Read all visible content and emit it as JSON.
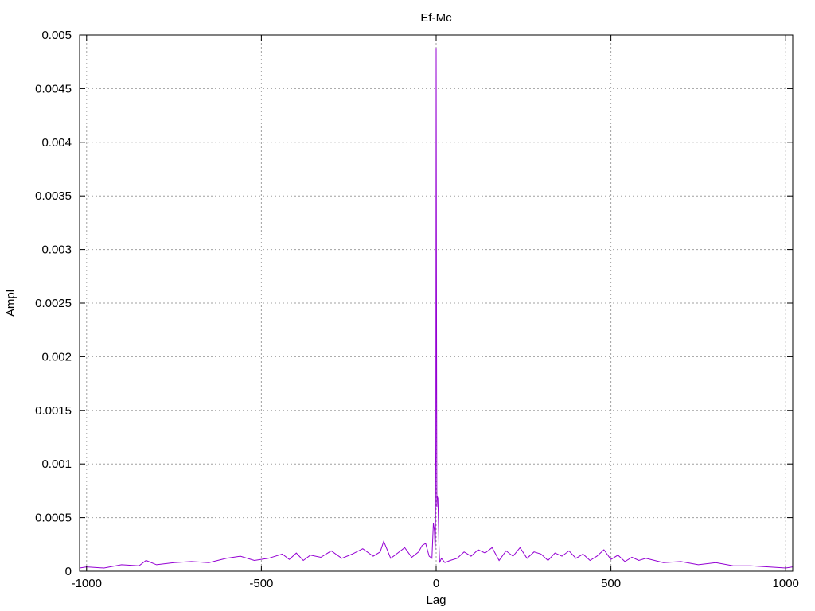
{
  "chart_data": {
    "type": "line",
    "title": "Ef-Mc",
    "xlabel": "Lag",
    "ylabel": "Ampl",
    "xlim": [
      -1020,
      1020
    ],
    "ylim": [
      0,
      0.005
    ],
    "grid": true,
    "xticks": [
      {
        "value": -1000,
        "label": "-1000"
      },
      {
        "value": -500,
        "label": "-500"
      },
      {
        "value": 0,
        "label": "0"
      },
      {
        "value": 500,
        "label": "500"
      },
      {
        "value": 1000,
        "label": "1000"
      }
    ],
    "yticks": [
      {
        "value": 0,
        "label": "0"
      },
      {
        "value": 0.0005,
        "label": "0.0005"
      },
      {
        "value": 0.001,
        "label": "0.001"
      },
      {
        "value": 0.0015,
        "label": "0.0015"
      },
      {
        "value": 0.002,
        "label": "0.002"
      },
      {
        "value": 0.0025,
        "label": "0.0025"
      },
      {
        "value": 0.003,
        "label": "0.003"
      },
      {
        "value": 0.0035,
        "label": "0.0035"
      },
      {
        "value": 0.004,
        "label": "0.004"
      },
      {
        "value": 0.0045,
        "label": "0.0045"
      },
      {
        "value": 0.005,
        "label": "0.005"
      }
    ],
    "series": [
      {
        "color": "#9400d3",
        "x": [
          -1020,
          -1000,
          -950,
          -900,
          -850,
          -830,
          -800,
          -750,
          -700,
          -650,
          -600,
          -560,
          -520,
          -480,
          -440,
          -420,
          -400,
          -380,
          -360,
          -330,
          -300,
          -270,
          -240,
          -210,
          -180,
          -160,
          -150,
          -130,
          -110,
          -90,
          -70,
          -50,
          -40,
          -30,
          -20,
          -12,
          -8,
          -5,
          -3,
          -2,
          -1,
          0,
          1,
          2,
          3,
          5,
          8,
          10,
          15,
          25,
          40,
          60,
          80,
          100,
          120,
          140,
          160,
          180,
          200,
          220,
          240,
          260,
          280,
          300,
          320,
          340,
          360,
          380,
          400,
          420,
          440,
          460,
          480,
          500,
          520,
          540,
          560,
          580,
          600,
          650,
          700,
          750,
          800,
          850,
          900,
          950,
          1000,
          1020
        ],
        "y": [
          3e-05,
          4e-05,
          3e-05,
          6e-05,
          5e-05,
          0.0001,
          6e-05,
          8e-05,
          9e-05,
          8e-05,
          0.00012,
          0.00014,
          0.0001,
          0.00012,
          0.00016,
          0.00011,
          0.00017,
          0.0001,
          0.00015,
          0.00013,
          0.00019,
          0.00012,
          0.00016,
          0.00021,
          0.00014,
          0.00018,
          0.00028,
          0.00012,
          0.00017,
          0.00022,
          0.00013,
          0.00018,
          0.00024,
          0.00026,
          0.00014,
          0.00012,
          0.00045,
          0.00038,
          0.0002,
          0.0003,
          0.0012,
          0.00488,
          0.00275,
          0.0006,
          0.0007,
          0.00068,
          0.00025,
          8e-05,
          0.00012,
          8e-05,
          0.0001,
          0.00012,
          0.00018,
          0.00014,
          0.0002,
          0.00017,
          0.00022,
          0.0001,
          0.00019,
          0.00014,
          0.00022,
          0.00012,
          0.00018,
          0.00016,
          0.0001,
          0.00017,
          0.00014,
          0.00019,
          0.00012,
          0.00016,
          0.0001,
          0.00014,
          0.0002,
          0.00011,
          0.00015,
          9e-05,
          0.00013,
          0.0001,
          0.00012,
          8e-05,
          9e-05,
          6e-05,
          8e-05,
          5e-05,
          5e-05,
          4e-05,
          3e-05,
          4e-05
        ]
      }
    ]
  }
}
